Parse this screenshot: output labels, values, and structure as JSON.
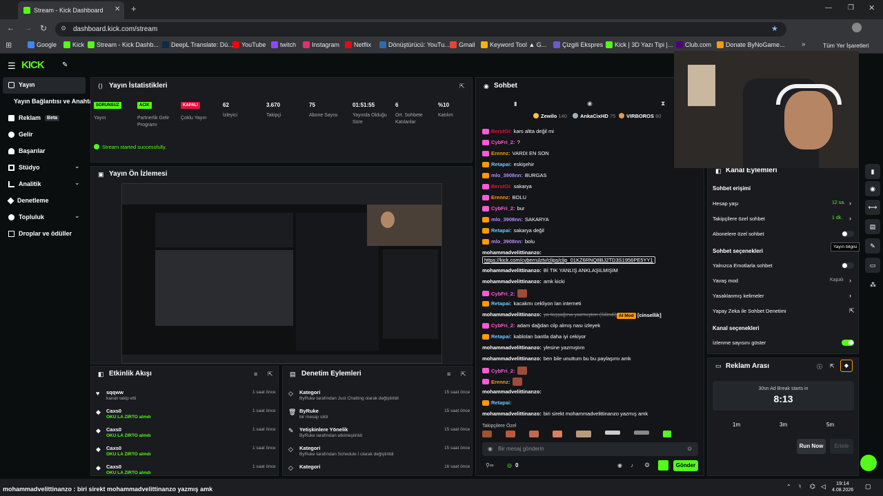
{
  "browser": {
    "tab_title": "Stream - Kick Dashboard",
    "url": "dashboard.kick.com/stream",
    "bookmarks": [
      "Google",
      "Kick",
      "Stream - Kick Dashb...",
      "DeepL Translate: Dü...",
      "YouTube",
      "twitch",
      "Instagram",
      "Netflix",
      "Dönüştürücü: YouTu...",
      "Gmail",
      "Keyword Tool ▲ G...",
      "Çizgili Ekspres",
      "Kick | 3D Yazı Tipi |...",
      "Club.com",
      "Donate ByNoGame..."
    ],
    "all_bookmarks": "Tüm Yer İşaretleri"
  },
  "sidebar": {
    "items": [
      "Yayın",
      "Yayın Bağlantısı ve Anahtarı",
      "Reklam",
      "Gelir",
      "Başarılar",
      "Stüdyo",
      "Analitik",
      "Denetleme",
      "Topluluk",
      "Droplar ve ödüller"
    ],
    "beta": "Beta"
  },
  "stats": {
    "title": "Yayın İstatistikleri",
    "badges": [
      {
        "label": "SORUNSUZ",
        "name": "Yayın",
        "color": "#53fc18"
      },
      {
        "label": "ACIK",
        "name": "Partnerlik Gelir Programı",
        "color": "#53fc18"
      },
      {
        "label": "KAPALI",
        "name": "Çoklu Yayın",
        "color": "#e9113c"
      }
    ],
    "items": [
      {
        "value": "62",
        "label": "İzleyici"
      },
      {
        "value": "3.670",
        "label": "Takipçi"
      },
      {
        "value": "75",
        "label": "Abone Sayısı"
      },
      {
        "value": "01:51:55",
        "label": "Yayında Olduğu Süre"
      },
      {
        "value": "6",
        "label": "Ort. Sohbete Katılanlar"
      },
      {
        "value": "%10",
        "label": "Katılım"
      }
    ],
    "success": "Stream started successfully."
  },
  "preview": {
    "title": "Yayın Ön İzlemesi"
  },
  "events": {
    "title": "Etkinlik Akışı",
    "rows": [
      {
        "user": "sqqww",
        "text": "kanalı takip etti",
        "time": "1 saat önce"
      },
      {
        "user": "Caxs0",
        "text": "OKU LA ZIRTO almdı",
        "time": "1 saat önce"
      },
      {
        "user": "Caxs0",
        "text": "OKU LA ZIRTO almdı",
        "time": "1 saat önce"
      },
      {
        "user": "Caxs0",
        "text": "OKU LA ZIRTO almdı",
        "time": "1 saat önce"
      },
      {
        "user": "Caxs0",
        "text": "OKU LA ZIRTO almdı",
        "time": "1 saat önce"
      }
    ]
  },
  "mod": {
    "title": "Denetim Eylemleri",
    "rows": [
      {
        "title": "Kategori",
        "text": "ByRuke tarafından Just Chatting olarak değiştirildi",
        "time": "15 saat önce"
      },
      {
        "title": "ByRuke",
        "text": "bir mesajı sildi",
        "time": "15 saat önce"
      },
      {
        "title": "Yetişkinlere Yönelik",
        "text": "ByRuke tarafından etkinleştirildi",
        "time": "15 saat önce"
      },
      {
        "title": "Kategori",
        "text": "ByRuke tarafından Schedule I olarak değiştirildi",
        "time": "15 saat önce"
      },
      {
        "title": "Kategori",
        "text": "",
        "time": "16 saat önce"
      }
    ]
  },
  "chat": {
    "title": "Sohbet",
    "top": [
      {
        "name": "Zewilo",
        "n": "140"
      },
      {
        "name": "AnkaCixHD",
        "n": "75"
      },
      {
        "name": "VIRBOROS",
        "n": "60"
      }
    ],
    "lines": [
      {
        "u": "BerstGI",
        "c": "#e9113c",
        "m": "kars altta değil mi"
      },
      {
        "u": "CybFri_2",
        "c": "#ff5ad6",
        "m": "?"
      },
      {
        "u": "Erennz",
        "c": "#ff9a00",
        "m": "VARDI EN SON"
      },
      {
        "u": "Retapai",
        "c": "#6ec8ff",
        "m": "eskişehir"
      },
      {
        "u": "mlo_3908nn",
        "c": "#b78cff",
        "m": "BURGAS"
      },
      {
        "u": "BerstGI",
        "c": "#e9113c",
        "m": "sakarya"
      },
      {
        "u": "Erennz",
        "c": "#ff9a00",
        "m": "BOLU"
      },
      {
        "u": "CybFri_2",
        "c": "#ff5ad6",
        "m": "bur"
      },
      {
        "u": "mlo_3908nn",
        "c": "#b78cff",
        "m": "SAKARYA"
      },
      {
        "u": "Retapai",
        "c": "#6ec8ff",
        "m": "sakarya değil"
      },
      {
        "u": "mlo_3908nn",
        "c": "#b78cff",
        "m": "bolu"
      },
      {
        "u": "mohammadvelittinanzo",
        "c": "#ffffff",
        "m": ""
      },
      {
        "u": "",
        "c": "#ffffff",
        "m": "https://kick.com/cyberrulztv/clips/clip_01KZ6RNQ8BJ2TD3S1956PE5YY1"
      },
      {
        "u": "mohammadvelittinanzo",
        "c": "#ffffff",
        "m": "Bİ TIK YANLIŞ ANKLAŞILMIŞIM"
      },
      {
        "u": "mohammadvelittinanzo",
        "c": "#ffffff",
        "m": "amk kicki"
      },
      {
        "u": "CybFri_2",
        "c": "#ff5ad6",
        "m": ""
      },
      {
        "u": "Retapai",
        "c": "#6ec8ff",
        "m": "kacakmı cekliyon lan interneti"
      },
      {
        "u": "mohammadvelittinanzo",
        "c": "#ffffff",
        "m": "ya taşşağına yazmıştım (Silindi)"
      },
      {
        "u": "CybFri_2",
        "c": "#ff5ad6",
        "m": "adam dağdan cilp almış nası izleyek"
      },
      {
        "u": "Retapai",
        "c": "#6ec8ff",
        "m": "kabloları bantla daha iyi cekiyor"
      },
      {
        "u": "mohammadvelittinanzo",
        "c": "#ffffff",
        "m": "ylesine yazmıştım"
      },
      {
        "u": "mohammadvelittinanzo",
        "c": "#ffffff",
        "m": "ben bile unuttum bu bu paylaşımı amk"
      },
      {
        "u": "CybFri_2",
        "c": "#ff5ad6",
        "m": ""
      },
      {
        "u": "Erennz",
        "c": "#ff9a00",
        "m": ""
      },
      {
        "u": "mohammadvelittinanzo",
        "c": "#ffffff",
        "m": ""
      },
      {
        "u": "Retapai",
        "c": "#6ec8ff",
        "m": ""
      },
      {
        "u": "mohammadvelittinanzo",
        "c": "#ffffff",
        "m": "biri sirekt mohammadvelittinanzo yazmış amk"
      }
    ],
    "aimod": "AI Mod",
    "aitag": "[cinsellik]",
    "subs": "Takipçilere Özel",
    "placeholder": "Bir mesaj gönderin",
    "count": "0",
    "send": "Gönder"
  },
  "channel": {
    "title": "Kanal Eylemleri",
    "access": "Sohbet erişimi",
    "rows": [
      {
        "label": "Hesap yaşı",
        "value": "12 sa."
      },
      {
        "label": "Takipçilere özel sohbet",
        "value": "1 dk."
      },
      {
        "label": "Abonelere özel sohbet",
        "value": ""
      }
    ],
    "chat_options": "Sohbet seçenekleri",
    "rows2": [
      {
        "label": "Yalnızca Emotlarla sohbet"
      },
      {
        "label": "Yavaş mod",
        "value": "Kapalı"
      },
      {
        "label": "Yasaklanmış kelimeler"
      },
      {
        "label": "Yapay Zeka ile Sohbet Denetimi"
      }
    ],
    "channel_options": "Kanal seçenekleri",
    "show_views": "İzlenme sayısını göster",
    "tooltip": "Yayın bilgisi"
  },
  "ad": {
    "title": "Reklam Arası",
    "starts": "30sn Ad Break starts in",
    "time": "8:13",
    "durations": [
      "1m",
      "3m",
      "5m"
    ],
    "run": "Run Now",
    "snooze": "Ertele"
  },
  "taskbar": {
    "ticker": "mohammadvelittinanzo : biri sirekt mohammadvelittinanzo yazmış amk",
    "time": "19:14",
    "date": "4.08.2026"
  }
}
